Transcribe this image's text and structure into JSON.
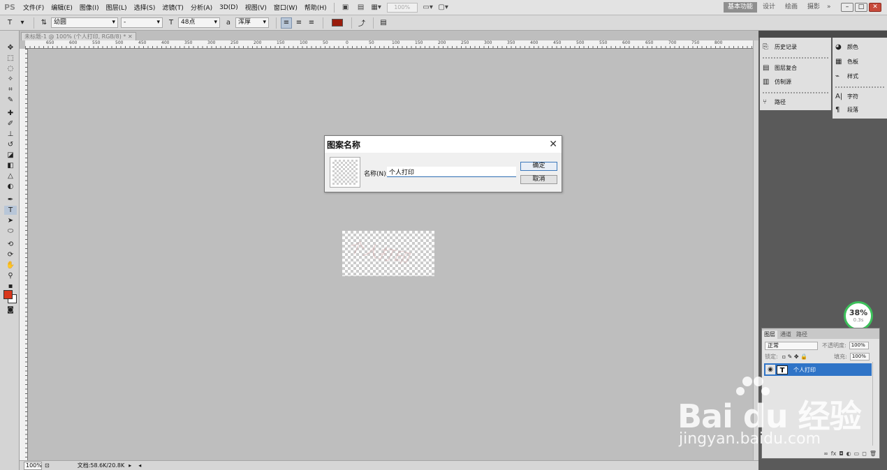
{
  "app": {
    "logo": "PS",
    "menu": [
      "文件(F)",
      "编辑(E)",
      "图像(I)",
      "图层(L)",
      "选择(S)",
      "滤镜(T)",
      "分析(A)",
      "3D(D)",
      "视图(V)",
      "窗口(W)",
      "帮助(H)"
    ],
    "zoom_display": "100%",
    "workspaces": [
      "基本功能",
      "设计",
      "绘画",
      "摄影"
    ],
    "more": "»"
  },
  "options_bar": {
    "tool_glyph": "T",
    "font_family": "幼圆",
    "font_style": "-",
    "font_size": "48点",
    "antialias": "浑厚",
    "text_color": "#9a1c0c"
  },
  "document": {
    "tab_title": "未标题-1 @ 100% (个人打印, RGB/8) *",
    "canvas_text": "个人打印",
    "status_zoom": "100%",
    "status_doc": "文档:58.6K/20.8K",
    "ruler_numbers": [
      "650",
      "600",
      "550",
      "500",
      "450",
      "400",
      "350",
      "300",
      "250",
      "200",
      "150",
      "100",
      "50",
      "0",
      "50",
      "100",
      "150",
      "200",
      "250",
      "300",
      "350",
      "400",
      "450",
      "500",
      "550",
      "600",
      "650",
      "700",
      "750",
      "800"
    ]
  },
  "dialog": {
    "title": "图案名称",
    "name_label": "名称(N):",
    "name_value": "个人打印",
    "ok_label": "确定",
    "cancel_label": "取消"
  },
  "panels": {
    "col1": [
      {
        "icon": "history-icon",
        "label": "历史记录"
      },
      {
        "icon": "layer-comps-icon",
        "label": "图层复合"
      },
      {
        "icon": "tool-presets-icon",
        "label": "仿制源"
      },
      {
        "icon": "navigator-icon",
        "label": "路径"
      }
    ],
    "col2": [
      {
        "icon": "color-icon",
        "label": "颜色"
      },
      {
        "icon": "swatches-icon",
        "label": "色板"
      },
      {
        "icon": "styles-icon",
        "label": "样式"
      },
      {
        "icon": "character-icon",
        "label": "字符"
      },
      {
        "icon": "paragraph-icon",
        "label": "段落"
      }
    ]
  },
  "timer": {
    "percent": "38%",
    "sub": "0.3s"
  },
  "layers": {
    "tabs": [
      "图层",
      "通道",
      "路径"
    ],
    "blend_mode": "正常",
    "opacity_label": "不透明度:",
    "opacity_value": "100%",
    "lock_label": "锁定:",
    "fill_label": "填充:",
    "fill_value": "100%",
    "layer_name": "个人打印",
    "layer_thumb": "T"
  },
  "watermark": {
    "brand": "Bai du 经验",
    "url": "jingyan.baidu.com"
  }
}
